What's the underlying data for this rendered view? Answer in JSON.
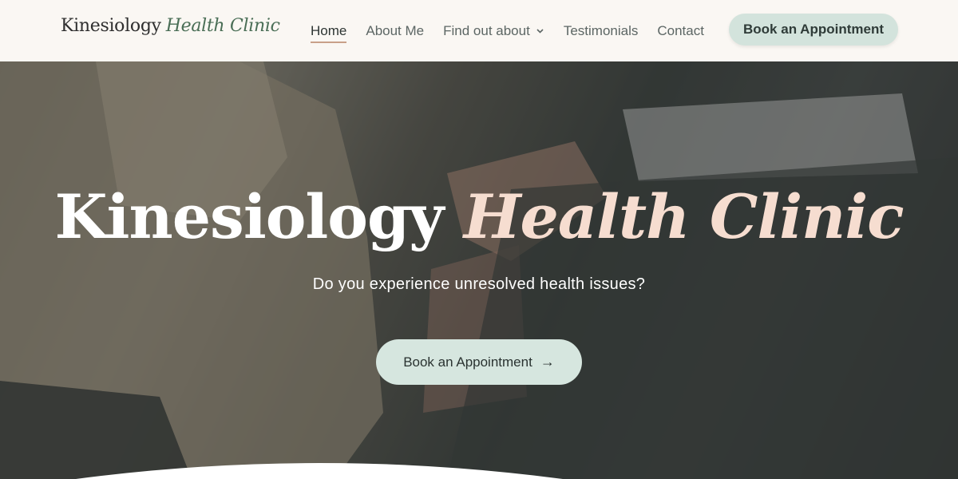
{
  "header": {
    "logo_main": "Kinesiology",
    "logo_accent": "Health Clinic",
    "nav": [
      {
        "label": "Home"
      },
      {
        "label": "About Me"
      },
      {
        "label": "Find out about"
      },
      {
        "label": "Testimonials"
      },
      {
        "label": "Contact"
      }
    ],
    "cta_label": "Book an Appointment"
  },
  "hero": {
    "title_main": "Kinesiology",
    "title_accent": "Health Clinic",
    "subtitle": "Do you experience unresolved health issues?",
    "cta_label": "Book an Appointment",
    "cta_arrow": "→"
  },
  "icons": {
    "dropdown": "chevron-down-icon",
    "cta_arrow": "arrow-right-icon"
  },
  "colors": {
    "header_bg": "#faf7f3",
    "accent_green": "#4a6e56",
    "button_bg": "#d3e3dc",
    "title_accent": "#f6ddd0",
    "underline": "#c9a089"
  }
}
